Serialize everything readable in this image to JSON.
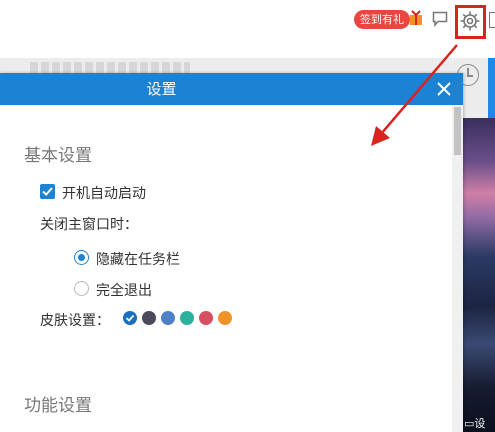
{
  "topbar": {
    "signin_badge": "签到有礼",
    "icons": [
      "gift-icon",
      "chat-icon",
      "gear-icon"
    ]
  },
  "background": {
    "photo_caption": "设"
  },
  "dialog": {
    "title": "设置",
    "basic_section": {
      "title": "基本设置",
      "autostart": {
        "label": "开机自动启动",
        "checked": true
      },
      "close_main_label": "关闭主窗口时：",
      "close_options": [
        {
          "label": "隐藏在任务栏",
          "selected": true
        },
        {
          "label": "完全退出",
          "selected": false
        }
      ],
      "skin_label": "皮肤设置：",
      "skins": [
        {
          "color": "#1b6fbf",
          "selected": true
        },
        {
          "color": "#4a4a5a",
          "selected": false
        },
        {
          "color": "#4f7fc6",
          "selected": false
        },
        {
          "color": "#2bb09b",
          "selected": false
        },
        {
          "color": "#d94f62",
          "selected": false
        },
        {
          "color": "#f0922a",
          "selected": false
        }
      ]
    },
    "function_section": {
      "title": "功能设置"
    }
  },
  "colors": {
    "accent": "#1b82d4",
    "highlight": "#d9231e"
  }
}
